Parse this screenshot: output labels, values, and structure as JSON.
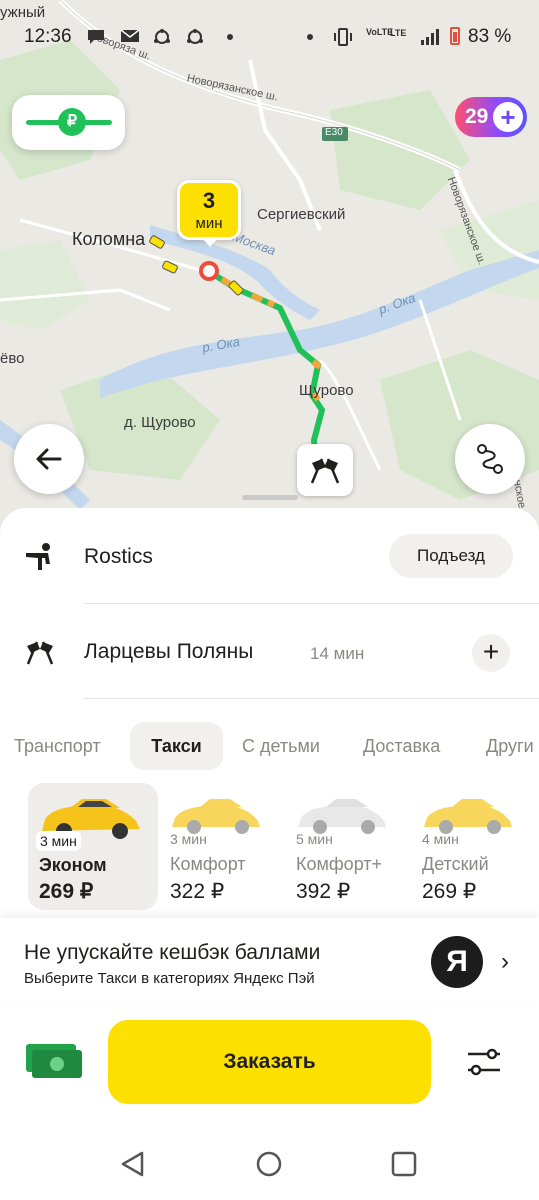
{
  "status_bar": {
    "carrier_left": "ужный",
    "time": "12:36",
    "network": "VoLTE",
    "lte": "LTE",
    "battery": "83 %"
  },
  "map": {
    "labels": {
      "kolomna": "Коломна",
      "sergievsky": "Сергиевский",
      "shchurovo": "Щурово",
      "d_shchurovo": "д. Щурово",
      "oka1": "р. Ока",
      "oka2": "р. Ока",
      "moskva": "Москва",
      "road1": "Новоряза ш.",
      "road2": "Новорязанское ш.",
      "road3": "Новорязанское ш.",
      "e30": "E30",
      "left_edge": "ёво",
      "right_edge": "нское"
    },
    "price_pill_symbol": "₽",
    "plus_badge": "29",
    "eta": {
      "value": "3",
      "unit": "мин"
    },
    "colors": {
      "route": "#21c15a",
      "water": "#c3d8ee",
      "greenery": "#d5e6cb"
    }
  },
  "route": {
    "from": "Rostics",
    "entrance_button": "Подъезд",
    "to": "Ларцевы Поляны",
    "to_time": "14 мин",
    "add_stop": "+"
  },
  "tabs": [
    "Транспорт",
    "Такси",
    "С детьми",
    "Доставка",
    "Други"
  ],
  "active_tab": "Такси",
  "tariffs": [
    {
      "eta": "3 мин",
      "name": "Эконом",
      "price": "269 ₽",
      "active": true,
      "color": "#f6c31a"
    },
    {
      "eta": "3 мин",
      "name": "Комфорт",
      "price": "322 ₽",
      "active": false,
      "color": "#f8d65c"
    },
    {
      "eta": "5 мин",
      "name": "Комфорт+",
      "price": "392 ₽",
      "active": false,
      "color": "#e8e8e8"
    },
    {
      "eta": "4 мин",
      "name": "Детский",
      "price": "269 ₽",
      "active": false,
      "color": "#f8d65c"
    }
  ],
  "promo": {
    "title": "Не упускайте кешбэк баллами",
    "subtitle": "Выберите Такси в категориях Яндекс Пэй",
    "logo": "Я",
    "chevron": "›"
  },
  "order_button": "Заказать"
}
